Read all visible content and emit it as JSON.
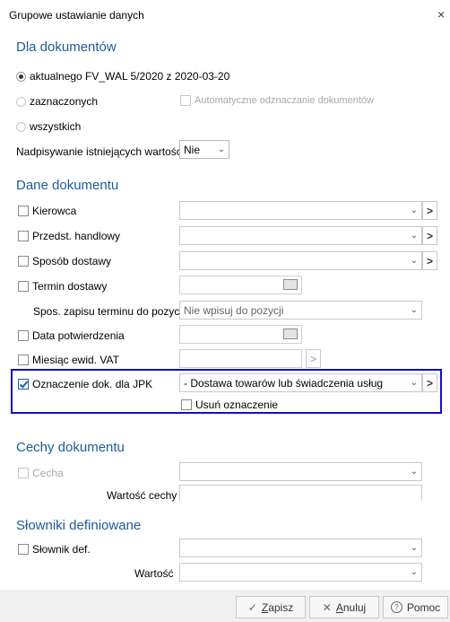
{
  "window": {
    "title": "Grupowe ustawianie danych",
    "close_glyph": "×"
  },
  "dla_dokumentow": {
    "heading": "Dla dokumentów",
    "radio_current": "aktualnego FV_WAL 5/2020 z 2020-03-20",
    "radio_selected": "zaznaczonych",
    "auto_uncheck": "Automatyczne odznaczanie dokumentów",
    "radio_all": "wszystkich",
    "overwrite_label": "Nadpisywanie istniejących wartości",
    "overwrite_value": "Nie"
  },
  "dane_dokumentu": {
    "heading": "Dane dokumentu",
    "kierowca": "Kierowca",
    "przedst": "Przedst. handlowy",
    "sposob": "Sposób dostawy",
    "termin": "Termin dostawy",
    "spos_zapisu_label": "Spos. zapisu terminu do pozycji",
    "spos_zapisu_value": "Nie wpisuj do pozycji",
    "data_potw": "Data potwierdzenia",
    "miesiac": "Miesiąc ewid. VAT",
    "jpk_label": "Oznaczenie dok. dla JPK",
    "jpk_value": "- Dostawa towarów lub świadczenia usług",
    "usun": "Usuń oznaczenie",
    "arrow": ">"
  },
  "cechy": {
    "heading": "Cechy dokumentu",
    "cecha": "Cecha",
    "wartosc_cechy": "Wartość cechy"
  },
  "slowniki": {
    "heading": "Słowniki definiowane",
    "slownik": "Słownik def.",
    "wartosc": "Wartość"
  },
  "footer": {
    "save_first": "Z",
    "save_rest": "apisz",
    "cancel_first": "A",
    "cancel_rest": "nuluj",
    "help": "Pomoc"
  }
}
